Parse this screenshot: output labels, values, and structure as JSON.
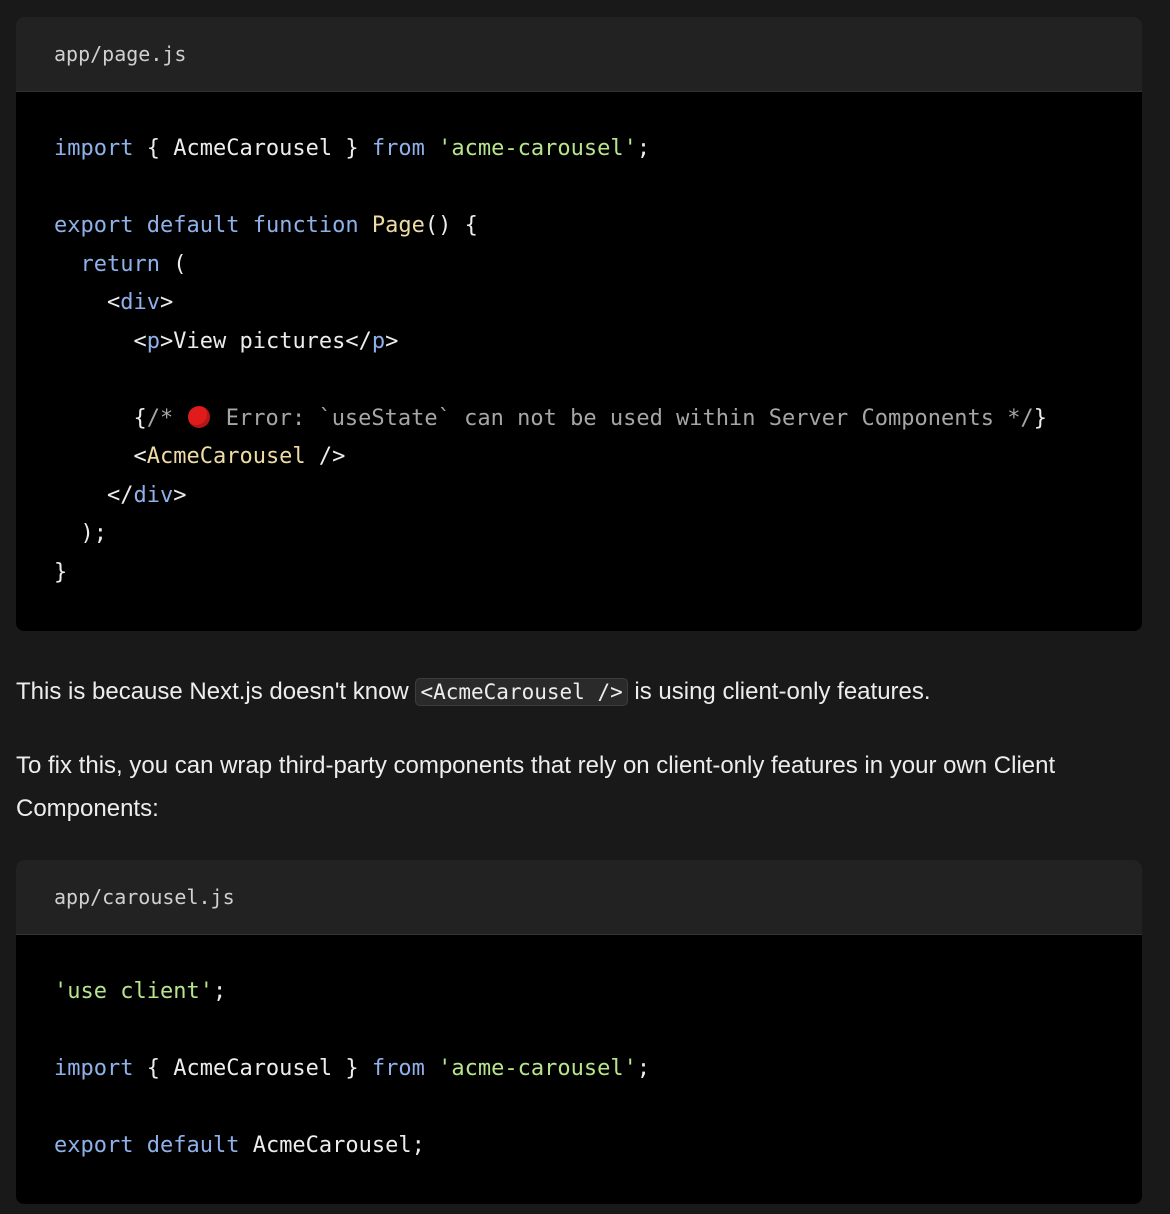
{
  "block1": {
    "filename": "app/page.js",
    "lines": {
      "l1": {
        "kw1": "import",
        "p1": " { AcmeCarousel } ",
        "kw2": "from",
        "sp": " ",
        "str": "'acme-carousel'",
        "end": ";"
      },
      "l3": {
        "kw1": "export",
        "sp1": " ",
        "kw2": "default",
        "sp2": " ",
        "kw3": "function",
        "sp3": " ",
        "fn": "Page",
        "end": "() {"
      },
      "l4": {
        "indent": "  ",
        "kw": "return",
        "end": " ("
      },
      "l5": {
        "indent": "    ",
        "lt": "<",
        "tag": "div",
        "gt": ">"
      },
      "l6": {
        "indent": "      ",
        "lt": "<",
        "tag": "p",
        "gt": ">",
        "text": "View pictures",
        "lt2": "</",
        "tag2": "p",
        "gt2": ">"
      },
      "l8": {
        "indent": "      ",
        "open": "{",
        "comment1": "/* ",
        "comment2": " Error: `useState` can not be used within Server Components */",
        "close": "}"
      },
      "l9": {
        "indent": "      ",
        "lt": "<",
        "comp": "AcmeCarousel",
        "end": " />"
      },
      "l10": {
        "indent": "    ",
        "lt": "</",
        "tag": "div",
        "gt": ">"
      },
      "l11": {
        "text": "  );"
      },
      "l12": {
        "text": "}"
      }
    }
  },
  "para1": {
    "before": "This is because Next.js doesn't know ",
    "code": "<AcmeCarousel />",
    "after": " is using client-only features."
  },
  "para2": {
    "text": "To fix this, you can wrap third-party components that rely on client-only features in your own Client Components:"
  },
  "block2": {
    "filename": "app/carousel.js",
    "lines": {
      "l1": {
        "str": "'use client'",
        "end": ";"
      },
      "l3": {
        "kw1": "import",
        "p1": " { AcmeCarousel } ",
        "kw2": "from",
        "sp": " ",
        "str": "'acme-carousel'",
        "end": ";"
      },
      "l5": {
        "kw1": "export",
        "sp1": " ",
        "kw2": "default",
        "rest": " AcmeCarousel;"
      }
    }
  },
  "colors": {
    "background": "#191919",
    "code_bg": "#000000",
    "header_bg": "#222222",
    "keyword": "#8fb1ea",
    "string": "#b6e58b",
    "function": "#efdca5",
    "comment": "#a6a6a6",
    "error_dot": "#e01b1b"
  },
  "icons": {
    "error": "red-circle-emoji"
  }
}
